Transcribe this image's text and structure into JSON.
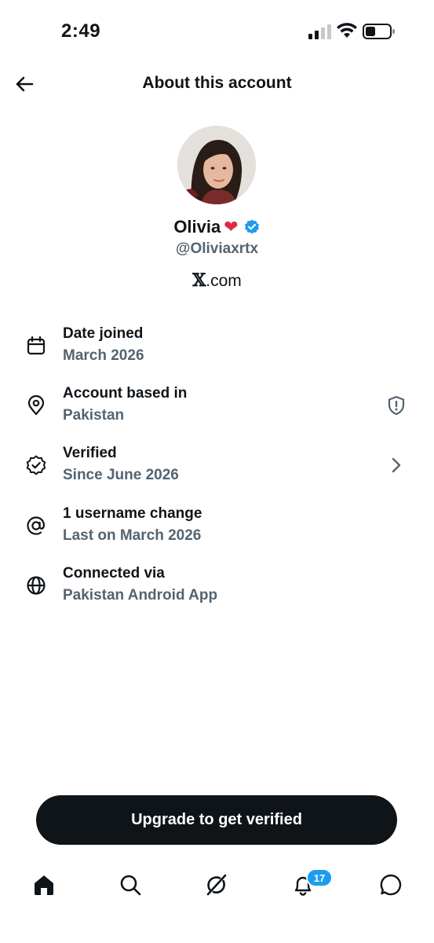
{
  "status_bar": {
    "time": "2:49"
  },
  "header": {
    "title": "About this account"
  },
  "profile": {
    "name": "Olivia",
    "heart": "❤",
    "handle": "@Oliviaxrtx",
    "site_prefix": "𝕏",
    "site_suffix": ".com"
  },
  "info": [
    {
      "label": "Date joined",
      "value": "March 2026",
      "icon": "calendar-icon"
    },
    {
      "label": "Account based in",
      "value": "Pakistan",
      "icon": "location-pin-icon",
      "trailing": "shield-alert-icon"
    },
    {
      "label": "Verified",
      "value": "Since June 2026",
      "icon": "verified-seal-icon",
      "trailing": "chevron-right-icon"
    },
    {
      "label": "1 username change",
      "value": "Last on March 2026",
      "icon": "at-sign-icon"
    },
    {
      "label": "Connected via",
      "value": "Pakistan Android App",
      "icon": "globe-icon"
    }
  ],
  "upgrade_button": {
    "label": "Upgrade to get verified"
  },
  "bottom_nav": {
    "items": [
      "home-icon",
      "search-icon",
      "grok-icon",
      "bell-icon",
      "messages-icon"
    ],
    "notification_count": "17"
  },
  "colors": {
    "primary_text": "#0f1419",
    "secondary_text": "#536471",
    "accent": "#1d9bf0"
  }
}
